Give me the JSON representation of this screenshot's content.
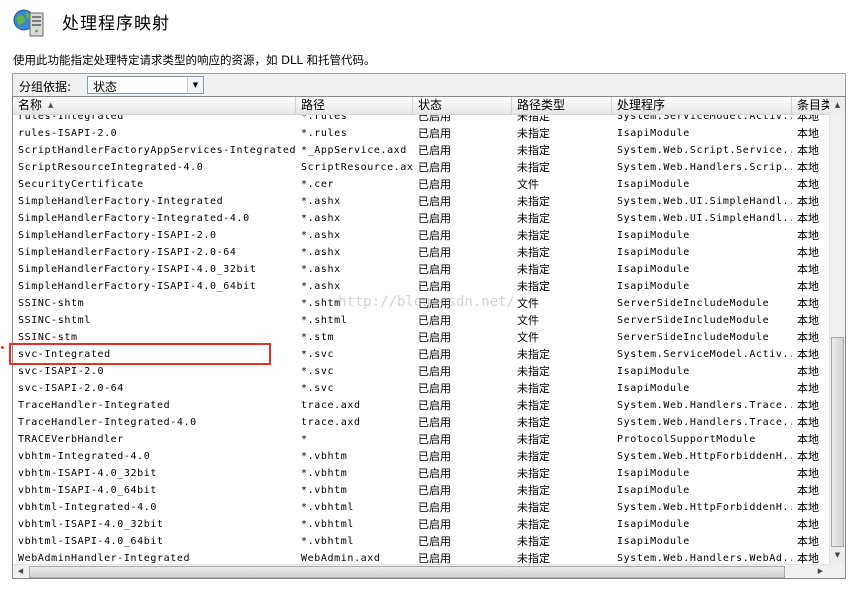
{
  "title": "处理程序映射",
  "description": "使用此功能指定处理特定请求类型的响应的资源，如 DLL 和托管代码。",
  "group_by": {
    "label": "分组依据:",
    "value": "状态"
  },
  "columns": [
    "名称",
    "路径",
    "状态",
    "路径类型",
    "处理程序",
    "条目类"
  ],
  "rows": [
    [
      "rules-Integrated",
      "*.rules",
      "已启用",
      "未指定",
      "System.ServiceModel.Activ...",
      "本地"
    ],
    [
      "rules-ISAPI-2.0",
      "*.rules",
      "已启用",
      "未指定",
      "IsapiModule",
      "本地"
    ],
    [
      "ScriptHandlerFactoryAppServices-Integrated...",
      "*_AppService.axd",
      "已启用",
      "未指定",
      "System.Web.Script.Service...",
      "本地"
    ],
    [
      "ScriptResourceIntegrated-4.0",
      "ScriptResource.axd",
      "已启用",
      "未指定",
      "System.Web.Handlers.Scrip...",
      "本地"
    ],
    [
      "SecurityCertificate",
      "*.cer",
      "已启用",
      "文件",
      "IsapiModule",
      "本地"
    ],
    [
      "SimpleHandlerFactory-Integrated",
      "*.ashx",
      "已启用",
      "未指定",
      "System.Web.UI.SimpleHandl...",
      "本地"
    ],
    [
      "SimpleHandlerFactory-Integrated-4.0",
      "*.ashx",
      "已启用",
      "未指定",
      "System.Web.UI.SimpleHandl...",
      "本地"
    ],
    [
      "SimpleHandlerFactory-ISAPI-2.0",
      "*.ashx",
      "已启用",
      "未指定",
      "IsapiModule",
      "本地"
    ],
    [
      "SimpleHandlerFactory-ISAPI-2.0-64",
      "*.ashx",
      "已启用",
      "未指定",
      "IsapiModule",
      "本地"
    ],
    [
      "SimpleHandlerFactory-ISAPI-4.0_32bit",
      "*.ashx",
      "已启用",
      "未指定",
      "IsapiModule",
      "本地"
    ],
    [
      "SimpleHandlerFactory-ISAPI-4.0_64bit",
      "*.ashx",
      "已启用",
      "未指定",
      "IsapiModule",
      "本地"
    ],
    [
      "SSINC-shtm",
      "*.shtm",
      "已启用",
      "文件",
      "ServerSideIncludeModule",
      "本地"
    ],
    [
      "SSINC-shtml",
      "*.shtml",
      "已启用",
      "文件",
      "ServerSideIncludeModule",
      "本地"
    ],
    [
      "SSINC-stm",
      "*.stm",
      "已启用",
      "文件",
      "ServerSideIncludeModule",
      "本地"
    ],
    [
      "svc-Integrated",
      "*.svc",
      "已启用",
      "未指定",
      "System.ServiceModel.Activ...",
      "本地"
    ],
    [
      "svc-ISAPI-2.0",
      "*.svc",
      "已启用",
      "未指定",
      "IsapiModule",
      "本地"
    ],
    [
      "svc-ISAPI-2.0-64",
      "*.svc",
      "已启用",
      "未指定",
      "IsapiModule",
      "本地"
    ],
    [
      "TraceHandler-Integrated",
      "trace.axd",
      "已启用",
      "未指定",
      "System.Web.Handlers.Trace...",
      "本地"
    ],
    [
      "TraceHandler-Integrated-4.0",
      "trace.axd",
      "已启用",
      "未指定",
      "System.Web.Handlers.Trace...",
      "本地"
    ],
    [
      "TRACEVerbHandler",
      "*",
      "已启用",
      "未指定",
      "ProtocolSupportModule",
      "本地"
    ],
    [
      "vbhtm-Integrated-4.0",
      "*.vbhtm",
      "已启用",
      "未指定",
      "System.Web.HttpForbiddenH...",
      "本地"
    ],
    [
      "vbhtm-ISAPI-4.0_32bit",
      "*.vbhtm",
      "已启用",
      "未指定",
      "IsapiModule",
      "本地"
    ],
    [
      "vbhtm-ISAPI-4.0_64bit",
      "*.vbhtm",
      "已启用",
      "未指定",
      "IsapiModule",
      "本地"
    ],
    [
      "vbhtml-Integrated-4.0",
      "*.vbhtml",
      "已启用",
      "未指定",
      "System.Web.HttpForbiddenH...",
      "本地"
    ],
    [
      "vbhtml-ISAPI-4.0_32bit",
      "*.vbhtml",
      "已启用",
      "未指定",
      "IsapiModule",
      "本地"
    ],
    [
      "vbhtml-ISAPI-4.0_64bit",
      "*.vbhtml",
      "已启用",
      "未指定",
      "IsapiModule",
      "本地"
    ],
    [
      "WebAdminHandler-Integrated",
      "WebAdmin.axd",
      "已启用",
      "未指定",
      "System.Web.Handlers.WebAd...",
      "本地"
    ]
  ],
  "highlighted_row": "svc-Integrated",
  "watermark": "http://blog.csdn.net/",
  "icons": {
    "app": "server-globe-icon",
    "sort": "sort-ascending-icon",
    "dropdown": "chevron-down-icon"
  },
  "colors": {
    "highlight": "#e8302a",
    "grid_border": "#828790",
    "header_divider": "#d5d5d5"
  }
}
